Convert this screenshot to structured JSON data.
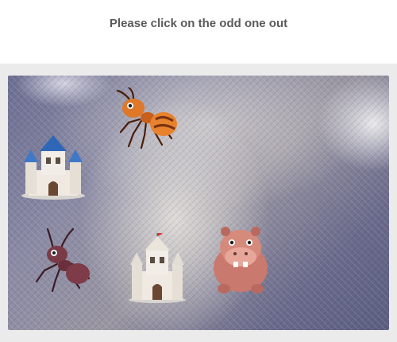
{
  "prompt": "Please click on the odd one out",
  "items": [
    {
      "name": "ant",
      "icon": "ant-icon"
    },
    {
      "name": "castle",
      "icon": "castle-icon"
    },
    {
      "name": "ant",
      "icon": "ant-icon"
    },
    {
      "name": "castle",
      "icon": "castle-icon"
    },
    {
      "name": "hippo",
      "icon": "hippo-icon"
    }
  ]
}
